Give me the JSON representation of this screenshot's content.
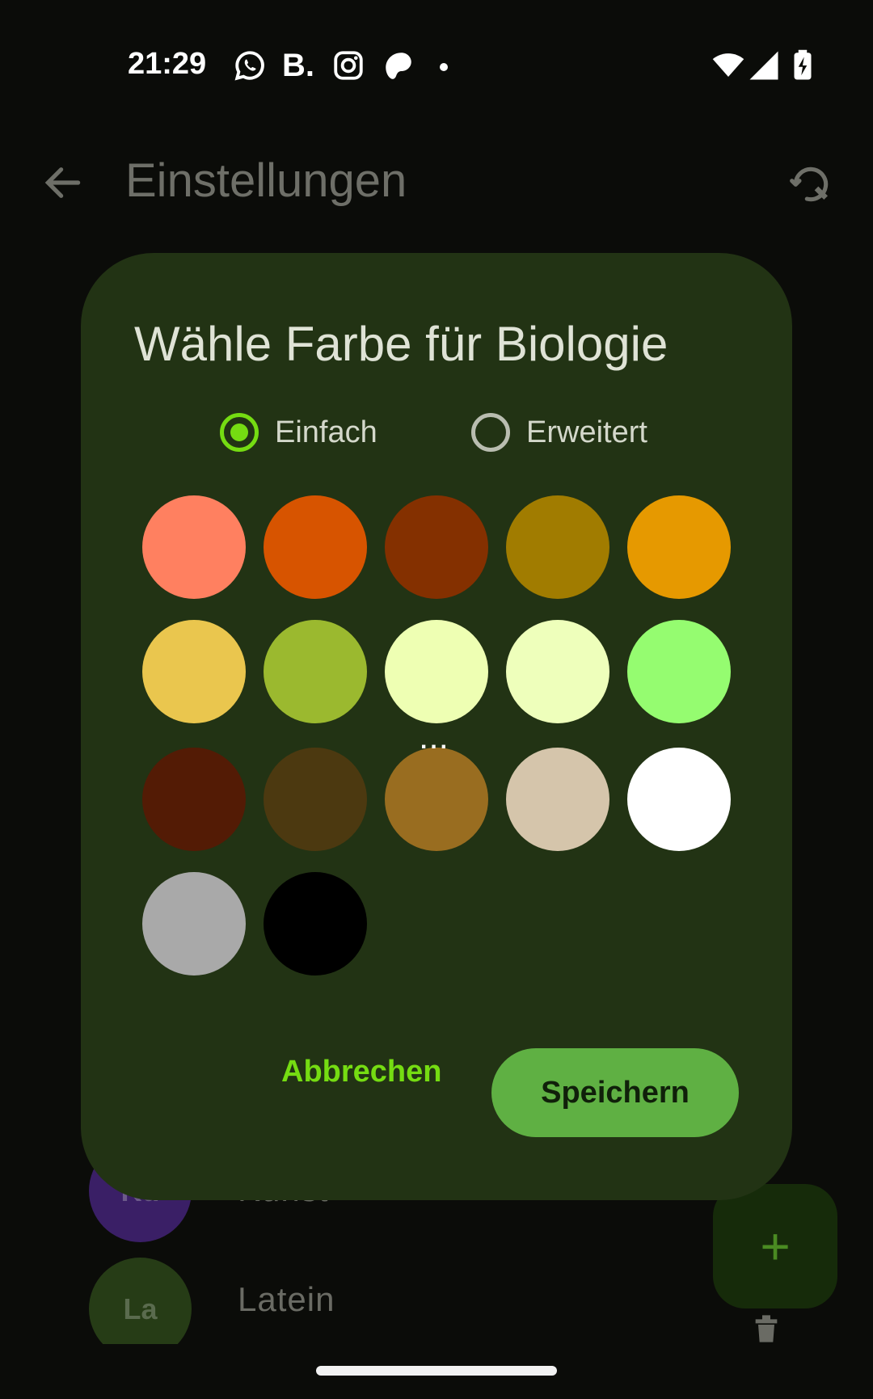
{
  "status_bar": {
    "time": "21:29",
    "notification_icons": [
      "whatsapp-icon",
      "b-icon",
      "instagram-icon",
      "patreon-icon",
      "dot-icon"
    ],
    "b_letter": "B.",
    "system_icons": [
      "wifi-icon",
      "signal-icon",
      "battery-charging-icon"
    ]
  },
  "app_bar": {
    "title": "Einstellungen",
    "back_icon": "arrow-back-icon",
    "action_icon": "sync-settings-icon"
  },
  "background_list": {
    "items": [
      {
        "abbr": "Ku",
        "label": "Kunst",
        "color": "#3a1f66"
      },
      {
        "abbr": "La",
        "label": "Latein",
        "color": "#263c16"
      }
    ],
    "fab_label": "+",
    "trash_icon": "trash-icon"
  },
  "dialog": {
    "title": "Wähle Farbe für Biologie",
    "modes": [
      {
        "label": "Einfach",
        "selected": true
      },
      {
        "label": "Erweitert",
        "selected": false
      }
    ],
    "swatches": [
      "#ff8060",
      "#d75400",
      "#843000",
      "#a17c00",
      "#e69900",
      "#eac64e",
      "#9bb92f",
      "#eeffb3",
      "#eeffbb",
      "#95fc70",
      "#531b05",
      "#4c3910",
      "#996d20",
      "#d5c5ab",
      "#ffffff",
      "#a9a9a9",
      "#000000"
    ],
    "selected_swatch_index": 7,
    "selected_marker": "...",
    "cancel_label": "Abbrechen",
    "save_label": "Speichern"
  },
  "colors": {
    "accent": "#75dc12",
    "dialog_bg": "#223314",
    "save_button": "#5fb043"
  }
}
